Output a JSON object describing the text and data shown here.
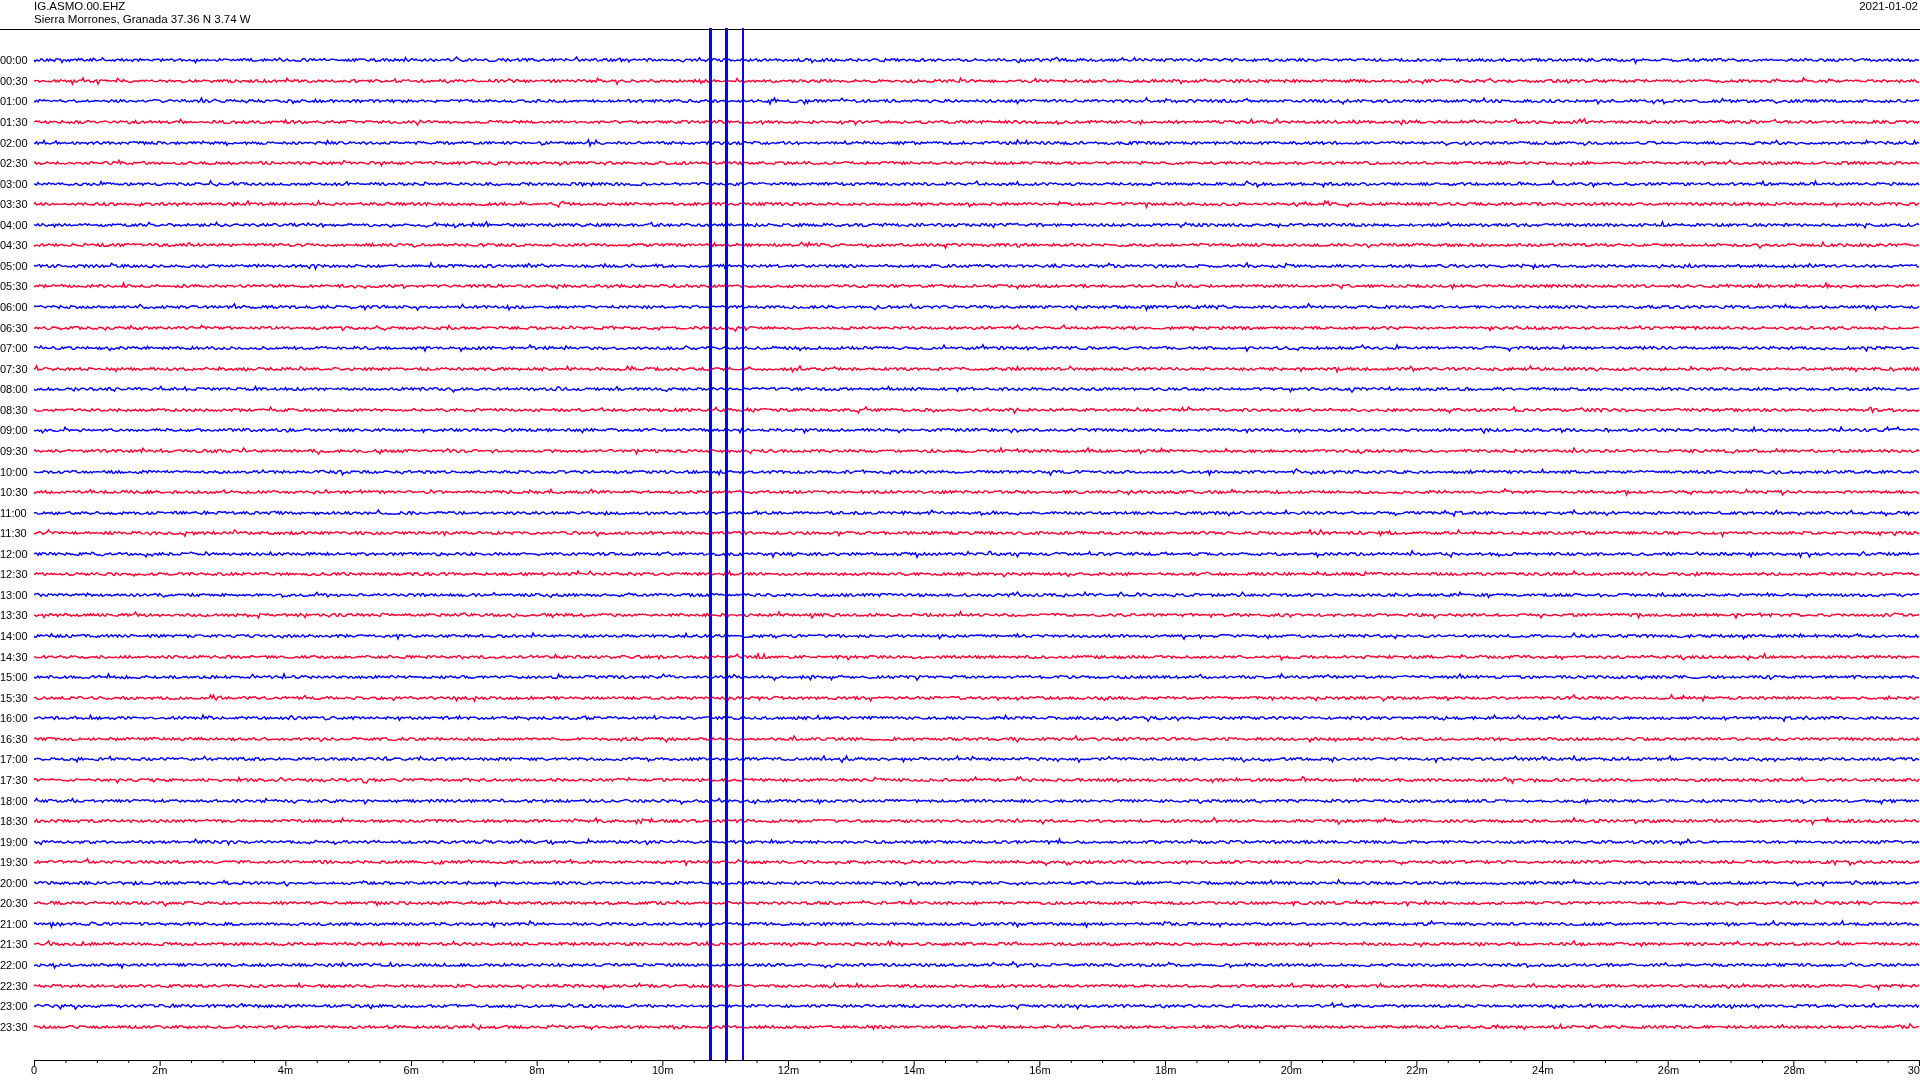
{
  "header": {
    "station": "IG.ASMO.00.EHZ",
    "location": "Sierra Morrones, Granada  37.36 N 3.74 W",
    "date": "2021-01-02"
  },
  "rows": [
    {
      "time": "00:00",
      "color": "#0000ff"
    },
    {
      "time": "00:30",
      "color": "#ff0033"
    },
    {
      "time": "01:00",
      "color": "#0000ff"
    },
    {
      "time": "01:30",
      "color": "#ff0033"
    },
    {
      "time": "02:00",
      "color": "#0000ff"
    },
    {
      "time": "02:30",
      "color": "#ff0033"
    },
    {
      "time": "03:00",
      "color": "#0000ff"
    },
    {
      "time": "03:30",
      "color": "#ff0033"
    },
    {
      "time": "04:00",
      "color": "#0000ff"
    },
    {
      "time": "04:30",
      "color": "#ff0033"
    },
    {
      "time": "05:00",
      "color": "#0000ff"
    },
    {
      "time": "05:30",
      "color": "#ff0033"
    },
    {
      "time": "06:00",
      "color": "#0000ff"
    },
    {
      "time": "06:30",
      "color": "#ff0033"
    },
    {
      "time": "07:00",
      "color": "#0000ff"
    },
    {
      "time": "07:30",
      "color": "#ff0033"
    },
    {
      "time": "08:00",
      "color": "#0000ff"
    },
    {
      "time": "08:30",
      "color": "#ff0033"
    },
    {
      "time": "09:00",
      "color": "#0000ff"
    },
    {
      "time": "09:30",
      "color": "#ff0033"
    },
    {
      "time": "10:00",
      "color": "#0000ff"
    },
    {
      "time": "10:30",
      "color": "#ff0033"
    },
    {
      "time": "11:00",
      "color": "#0000ff"
    },
    {
      "time": "11:30",
      "color": "#ff0033"
    },
    {
      "time": "12:00",
      "color": "#0000ff"
    },
    {
      "time": "12:30",
      "color": "#ff0033"
    },
    {
      "time": "13:00",
      "color": "#0000ff"
    },
    {
      "time": "13:30",
      "color": "#ff0033"
    },
    {
      "time": "14:00",
      "color": "#0000ff"
    },
    {
      "time": "14:30",
      "color": "#ff0033"
    },
    {
      "time": "15:00",
      "color": "#0000ff"
    },
    {
      "time": "15:30",
      "color": "#ff0033"
    },
    {
      "time": "16:00",
      "color": "#0000ff"
    },
    {
      "time": "16:30",
      "color": "#ff0033"
    },
    {
      "time": "17:00",
      "color": "#0000ff"
    },
    {
      "time": "17:30",
      "color": "#ff0033"
    },
    {
      "time": "18:00",
      "color": "#0000ff"
    },
    {
      "time": "18:30",
      "color": "#ff0033"
    },
    {
      "time": "19:00",
      "color": "#0000ff"
    },
    {
      "time": "19:30",
      "color": "#ff0033"
    },
    {
      "time": "20:00",
      "color": "#0000ff"
    },
    {
      "time": "20:30",
      "color": "#ff0033"
    },
    {
      "time": "21:00",
      "color": "#0000ff"
    },
    {
      "time": "21:30",
      "color": "#ff0033"
    },
    {
      "time": "22:00",
      "color": "#0000ff"
    },
    {
      "time": "22:30",
      "color": "#ff0033"
    },
    {
      "time": "23:00",
      "color": "#0000ff"
    },
    {
      "time": "23:30",
      "color": "#ff0033"
    }
  ],
  "x_axis": {
    "labels": [
      "0",
      "2m",
      "4m",
      "6m",
      "8m",
      "10m",
      "12m",
      "14m",
      "16m",
      "18m",
      "20m",
      "22m",
      "24m",
      "26m",
      "28m",
      "30"
    ]
  }
}
